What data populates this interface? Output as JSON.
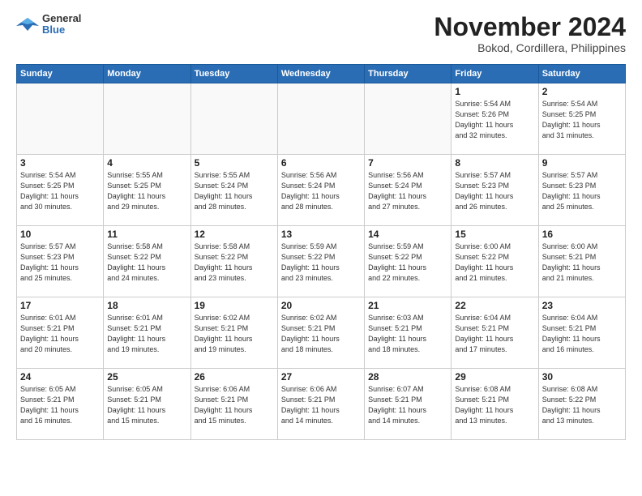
{
  "header": {
    "logo": {
      "general": "General",
      "blue": "Blue"
    },
    "title": "November 2024",
    "location": "Bokod, Cordillera, Philippines"
  },
  "days_of_week": [
    "Sunday",
    "Monday",
    "Tuesday",
    "Wednesday",
    "Thursday",
    "Friday",
    "Saturday"
  ],
  "weeks": [
    [
      {
        "day": "",
        "info": ""
      },
      {
        "day": "",
        "info": ""
      },
      {
        "day": "",
        "info": ""
      },
      {
        "day": "",
        "info": ""
      },
      {
        "day": "",
        "info": ""
      },
      {
        "day": "1",
        "info": "Sunrise: 5:54 AM\nSunset: 5:26 PM\nDaylight: 11 hours\nand 32 minutes."
      },
      {
        "day": "2",
        "info": "Sunrise: 5:54 AM\nSunset: 5:25 PM\nDaylight: 11 hours\nand 31 minutes."
      }
    ],
    [
      {
        "day": "3",
        "info": "Sunrise: 5:54 AM\nSunset: 5:25 PM\nDaylight: 11 hours\nand 30 minutes."
      },
      {
        "day": "4",
        "info": "Sunrise: 5:55 AM\nSunset: 5:25 PM\nDaylight: 11 hours\nand 29 minutes."
      },
      {
        "day": "5",
        "info": "Sunrise: 5:55 AM\nSunset: 5:24 PM\nDaylight: 11 hours\nand 28 minutes."
      },
      {
        "day": "6",
        "info": "Sunrise: 5:56 AM\nSunset: 5:24 PM\nDaylight: 11 hours\nand 28 minutes."
      },
      {
        "day": "7",
        "info": "Sunrise: 5:56 AM\nSunset: 5:24 PM\nDaylight: 11 hours\nand 27 minutes."
      },
      {
        "day": "8",
        "info": "Sunrise: 5:57 AM\nSunset: 5:23 PM\nDaylight: 11 hours\nand 26 minutes."
      },
      {
        "day": "9",
        "info": "Sunrise: 5:57 AM\nSunset: 5:23 PM\nDaylight: 11 hours\nand 25 minutes."
      }
    ],
    [
      {
        "day": "10",
        "info": "Sunrise: 5:57 AM\nSunset: 5:23 PM\nDaylight: 11 hours\nand 25 minutes."
      },
      {
        "day": "11",
        "info": "Sunrise: 5:58 AM\nSunset: 5:22 PM\nDaylight: 11 hours\nand 24 minutes."
      },
      {
        "day": "12",
        "info": "Sunrise: 5:58 AM\nSunset: 5:22 PM\nDaylight: 11 hours\nand 23 minutes."
      },
      {
        "day": "13",
        "info": "Sunrise: 5:59 AM\nSunset: 5:22 PM\nDaylight: 11 hours\nand 23 minutes."
      },
      {
        "day": "14",
        "info": "Sunrise: 5:59 AM\nSunset: 5:22 PM\nDaylight: 11 hours\nand 22 minutes."
      },
      {
        "day": "15",
        "info": "Sunrise: 6:00 AM\nSunset: 5:22 PM\nDaylight: 11 hours\nand 21 minutes."
      },
      {
        "day": "16",
        "info": "Sunrise: 6:00 AM\nSunset: 5:21 PM\nDaylight: 11 hours\nand 21 minutes."
      }
    ],
    [
      {
        "day": "17",
        "info": "Sunrise: 6:01 AM\nSunset: 5:21 PM\nDaylight: 11 hours\nand 20 minutes."
      },
      {
        "day": "18",
        "info": "Sunrise: 6:01 AM\nSunset: 5:21 PM\nDaylight: 11 hours\nand 19 minutes."
      },
      {
        "day": "19",
        "info": "Sunrise: 6:02 AM\nSunset: 5:21 PM\nDaylight: 11 hours\nand 19 minutes."
      },
      {
        "day": "20",
        "info": "Sunrise: 6:02 AM\nSunset: 5:21 PM\nDaylight: 11 hours\nand 18 minutes."
      },
      {
        "day": "21",
        "info": "Sunrise: 6:03 AM\nSunset: 5:21 PM\nDaylight: 11 hours\nand 18 minutes."
      },
      {
        "day": "22",
        "info": "Sunrise: 6:04 AM\nSunset: 5:21 PM\nDaylight: 11 hours\nand 17 minutes."
      },
      {
        "day": "23",
        "info": "Sunrise: 6:04 AM\nSunset: 5:21 PM\nDaylight: 11 hours\nand 16 minutes."
      }
    ],
    [
      {
        "day": "24",
        "info": "Sunrise: 6:05 AM\nSunset: 5:21 PM\nDaylight: 11 hours\nand 16 minutes."
      },
      {
        "day": "25",
        "info": "Sunrise: 6:05 AM\nSunset: 5:21 PM\nDaylight: 11 hours\nand 15 minutes."
      },
      {
        "day": "26",
        "info": "Sunrise: 6:06 AM\nSunset: 5:21 PM\nDaylight: 11 hours\nand 15 minutes."
      },
      {
        "day": "27",
        "info": "Sunrise: 6:06 AM\nSunset: 5:21 PM\nDaylight: 11 hours\nand 14 minutes."
      },
      {
        "day": "28",
        "info": "Sunrise: 6:07 AM\nSunset: 5:21 PM\nDaylight: 11 hours\nand 14 minutes."
      },
      {
        "day": "29",
        "info": "Sunrise: 6:08 AM\nSunset: 5:21 PM\nDaylight: 11 hours\nand 13 minutes."
      },
      {
        "day": "30",
        "info": "Sunrise: 6:08 AM\nSunset: 5:22 PM\nDaylight: 11 hours\nand 13 minutes."
      }
    ]
  ]
}
